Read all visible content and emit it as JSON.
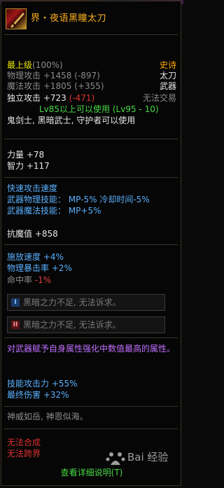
{
  "item": {
    "name": "界・夜语黑瞳太刀",
    "grade": "最上级",
    "grade_pct": "(100%)",
    "rarity": "史诗",
    "type_major": "太刀",
    "type_minor": "武器",
    "trade": "无法交易"
  },
  "stats": {
    "phys_attack": {
      "label": "物理攻击",
      "value": "+1458",
      "diff": "(-897)"
    },
    "mag_attack": {
      "label": "魔法攻击",
      "value": "+1805",
      "diff": "(+355)"
    },
    "indep_attack": {
      "label": "独立攻击",
      "value": "+723",
      "diff": "(-471)"
    }
  },
  "requirement": "Lv85以上可以使用 (Lv95 - 10)",
  "classes": "鬼剑士, 黑暗武士, 守护者可以使用",
  "attrs": [
    {
      "label": "力量",
      "value": "+78"
    },
    {
      "label": "智力",
      "value": "+117"
    }
  ],
  "skills": {
    "title": "快速攻击速度",
    "line1": "武器物理技能： MP-5% 冷却时间-5%",
    "line2": "武器魔法技能： MP+5%"
  },
  "resist": {
    "label": "抗魔值",
    "value": "+858"
  },
  "speeds": [
    {
      "label": "施放速度",
      "value": "+4%"
    },
    {
      "label": "物理暴击率",
      "value": "+2%"
    },
    {
      "label": "命中率",
      "value": "-1%"
    }
  ],
  "locks": [
    {
      "badge": "I",
      "text": "黑暗之力不足, 无法诉求。"
    },
    {
      "badge": "II",
      "text": "黑暗之力不足, 无法诉求。"
    }
  ],
  "special_desc": "对武器赋予自身属性强化中数值最高的属性。",
  "bonus": [
    {
      "label": "技能攻击力",
      "value": "+55%"
    },
    {
      "label": "最终伤害",
      "value": "+32%"
    }
  ],
  "flavor": "神威如岳, 神恩似海。",
  "restrictions": [
    "无法合成",
    "无法跨界"
  ],
  "footer_link": "查看详细说明(T)",
  "watermark": "Bai 经验",
  "colors": {
    "name": "#ffb020",
    "rarity": "#ffa800",
    "negative": "#e23030",
    "requirement": "#48d848",
    "skill": "#5ab0ff",
    "attr_yellow": "#e6e600",
    "special": "#c070ff"
  }
}
